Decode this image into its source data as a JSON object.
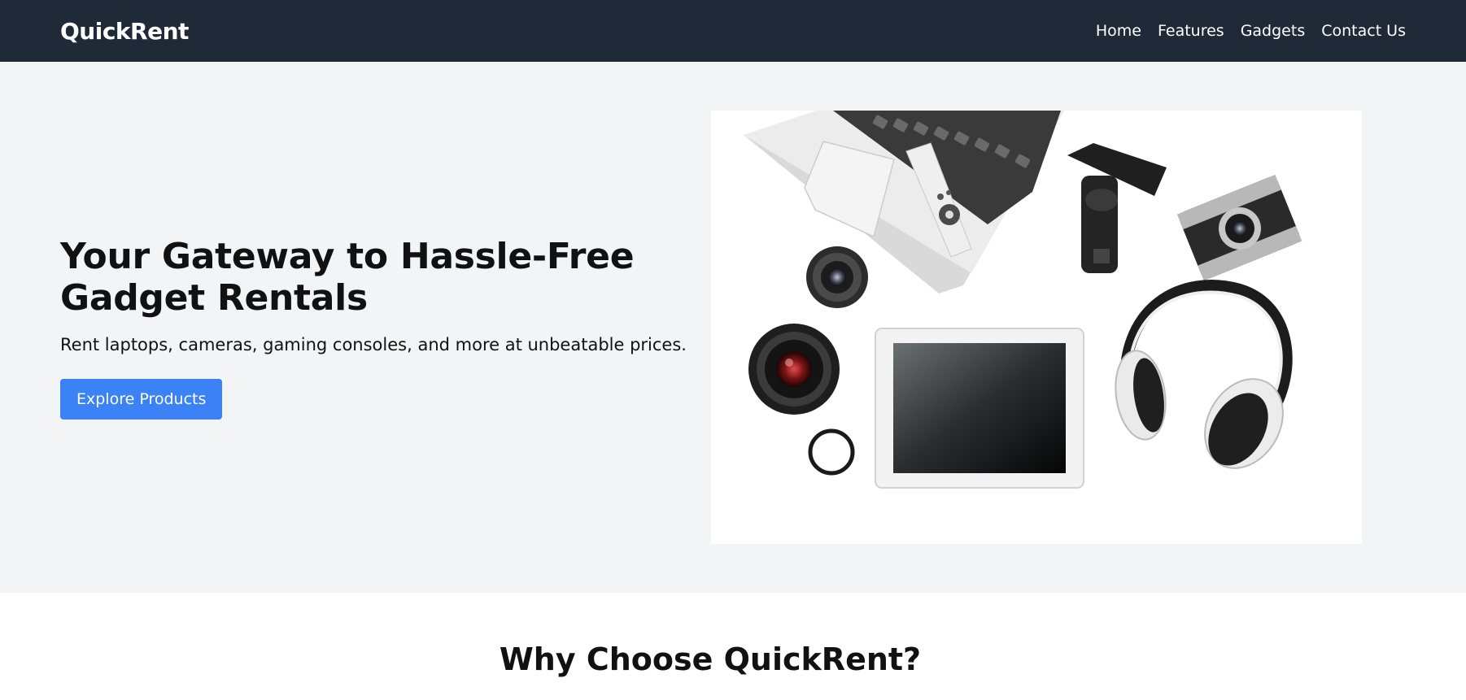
{
  "navbar": {
    "brand": "QuickRent",
    "links": [
      "Home",
      "Features",
      "Gadgets",
      "Contact Us"
    ]
  },
  "hero": {
    "title": "Your Gateway to Hassle-Free Gadget Rentals",
    "subtitle": "Rent laptops, cameras, gaming consoles, and more at unbeatable prices.",
    "cta_label": "Explore Products"
  },
  "features": {
    "title": "Why Choose QuickRent?"
  },
  "colors": {
    "navbar_bg": "#1f2937",
    "hero_bg": "#f3f4f6",
    "accent": "#3b82f6"
  }
}
